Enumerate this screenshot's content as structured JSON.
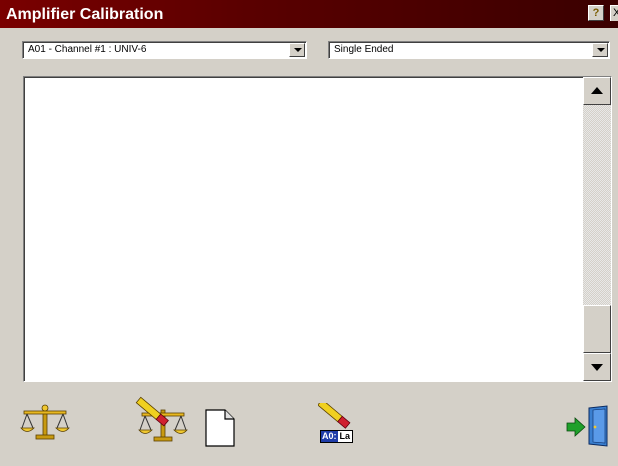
{
  "window": {
    "title": "Amplifier Calibration",
    "help_glyph": "?",
    "close_glyph": "X"
  },
  "channel_select": {
    "value": "A01 - Channel #1 : UNIV-6"
  },
  "mode_select": {
    "value": "Single Ended"
  },
  "toolbar": {
    "calibrate_icon": "balance-scale-icon",
    "erase_calibration_icon": "balance-scale-eraser-icon",
    "new_document_icon": "blank-document-icon",
    "erase_labels_icon": "eraser-label-icon",
    "erase_labels_badge_channel": "A0:",
    "erase_labels_badge_label": "La",
    "exit_icon": "exit-door-icon"
  },
  "colors": {
    "titlebar": "#7a0000",
    "face": "#d4d0c8",
    "door": "#3a7fd0",
    "arrow": "#1fa02a",
    "eraser": "#d02030",
    "pencil": "#f0d020"
  }
}
